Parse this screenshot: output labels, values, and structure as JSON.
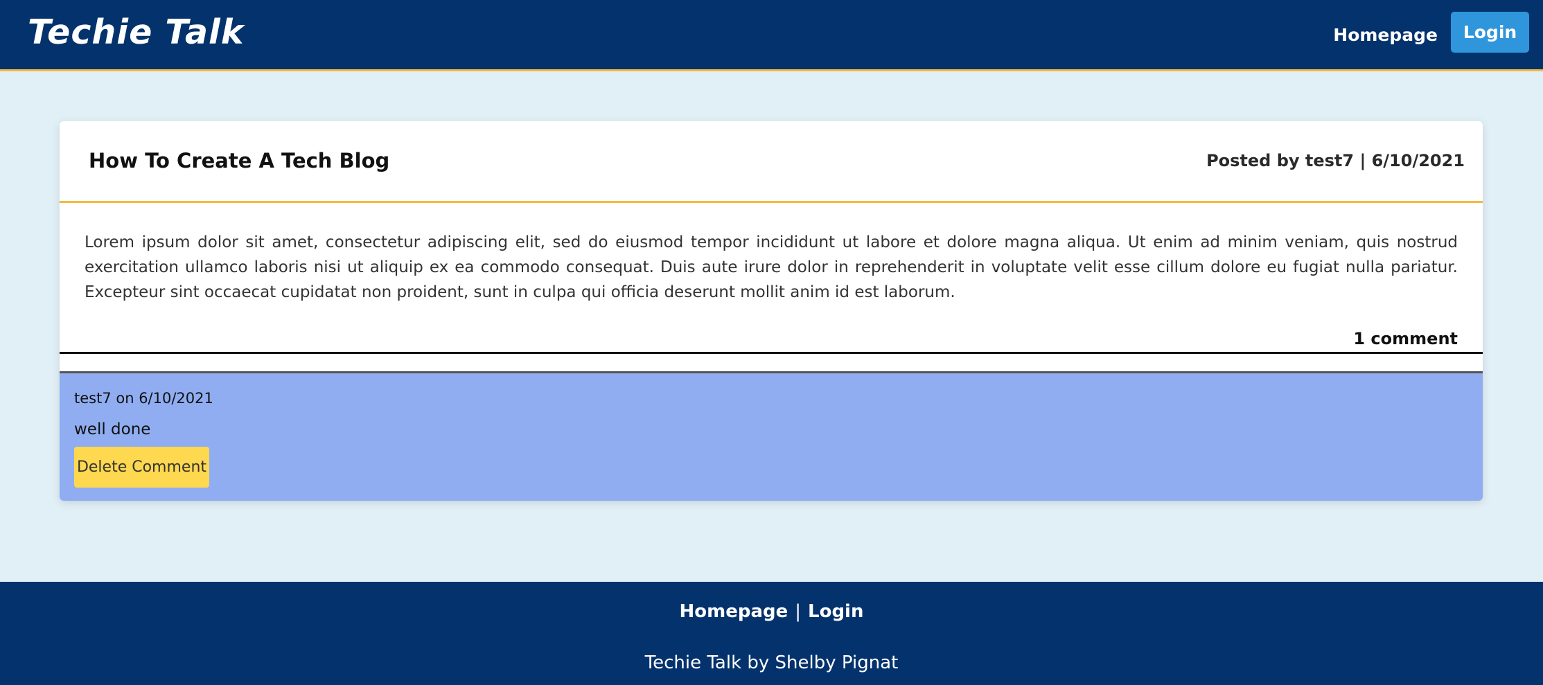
{
  "header": {
    "brand": "Techie Talk",
    "nav_homepage": "Homepage",
    "nav_login": "Login",
    "colors": {
      "background": "#04326c",
      "accent": "#f4b940",
      "login_button": "#2f96dc"
    }
  },
  "post": {
    "title": "How To Create A Tech Blog",
    "meta": "Posted by test7 | 6/10/2021",
    "body": "Lorem ipsum dolor sit amet, consectetur adipiscing elit, sed do eiusmod tempor incididunt ut labore et dolore magna aliqua. Ut enim ad minim veniam, quis nostrud exercitation ullamco laboris nisi ut aliquip ex ea commodo consequat. Duis aute irure dolor in reprehenderit in voluptate velit esse cillum dolore eu fugiat nulla pariatur. Excepteur sint occaecat cupidatat non proident, sunt in culpa qui officia deserunt mollit anim id est laborum.",
    "comment_count": "1 comment"
  },
  "comments": [
    {
      "meta": "test7 on 6/10/2021",
      "text": "well done",
      "delete_label": "Delete Comment",
      "colors": {
        "background": "#8fadf0",
        "delete_button": "#fed84e"
      }
    }
  ],
  "footer": {
    "link_homepage": "Homepage",
    "separator": "|",
    "link_login": "Login",
    "credit": "Techie Talk by Shelby Pignat"
  }
}
